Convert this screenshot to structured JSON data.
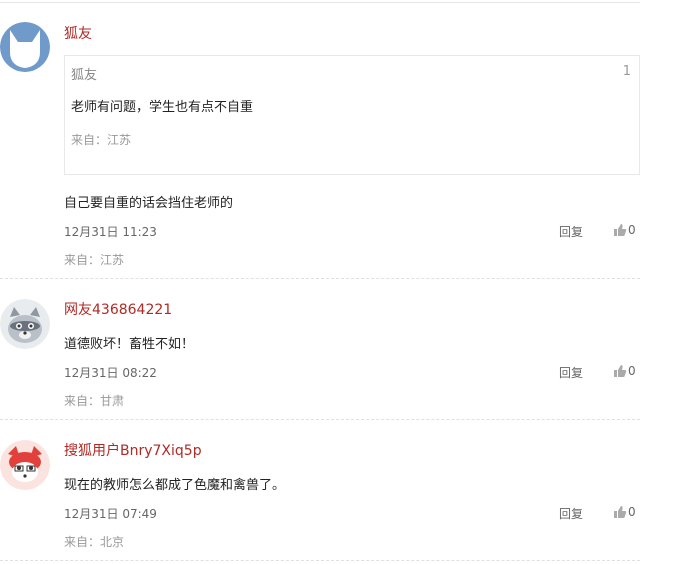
{
  "comments": [
    {
      "username": "狐友",
      "avatar_icon": "fox-silhouette-icon",
      "quote": {
        "username": "狐友",
        "floor": "1",
        "text": "老师有问题，学生也有点不自重",
        "from": "来自：江苏"
      },
      "content": "自己要自重的话会挡住老师的",
      "time": "12月31日 11:23",
      "reply_label": "回复",
      "likes": "0",
      "from": "来自：江苏"
    },
    {
      "username": "网友436864221",
      "avatar_icon": "raccoon-avatar-icon",
      "content": "道德败坏！畜牲不如！",
      "time": "12月31日 08:22",
      "reply_label": "回复",
      "likes": "0",
      "from": "来自：甘肃"
    },
    {
      "username": "搜狐用户Bnry7Xiq5p",
      "avatar_icon": "red-fox-avatar-icon",
      "content": "现在的教师怎么都成了色魔和禽兽了。",
      "time": "12月31日 07:49",
      "reply_label": "回复",
      "likes": "0",
      "from": "来自：北京"
    }
  ],
  "colors": {
    "username": "#b02a25",
    "meta": "#666666",
    "from": "#999999"
  }
}
